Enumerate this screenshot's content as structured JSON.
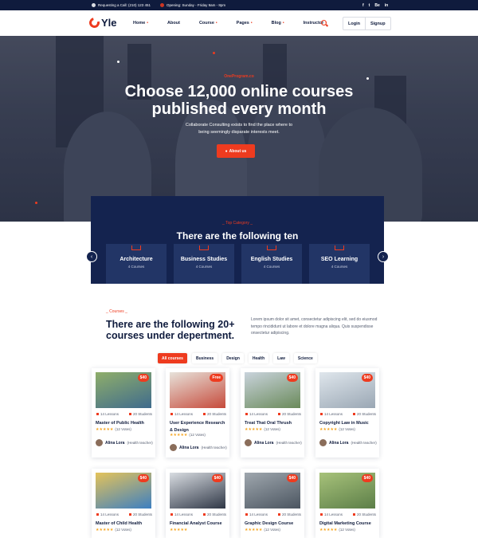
{
  "topbar": {
    "call": "Requesting a Call: (210) 123 451",
    "opening": "Opening: Sunday - Friday 9am - 8pm",
    "social": [
      "f",
      "t",
      "Be",
      "in"
    ]
  },
  "header": {
    "logo_text": "Yle",
    "nav": [
      "Home",
      "About",
      "Course",
      "Pages",
      "Blog",
      "Instructor"
    ],
    "login": "Login",
    "signup": "Signup"
  },
  "hero": {
    "subtitle": "OneProgram.co",
    "title_line1": "Choose 12,000 online courses",
    "title_line2": "published every month",
    "desc_line1": "Collaborate Consulting exists to find the place where to",
    "desc_line2": "being seemingly disparate interests meet.",
    "button": "About us"
  },
  "category": {
    "subtitle": "_ Top Category _",
    "title": "There are the following ten",
    "cards": [
      {
        "title": "Architecture",
        "count": "4 Courses"
      },
      {
        "title": "Business Studies",
        "count": "4 Courses"
      },
      {
        "title": "English Studies",
        "count": "4 Courses"
      },
      {
        "title": "SEO Learning",
        "count": "4 Courses"
      }
    ]
  },
  "courses": {
    "subtitle": "_ Courses _",
    "title": "There are the following 20+ courses under depertment.",
    "description": "Lorem ipsum dolor sit amet, consectetur adipiscing elit, sed do eiusmod tempo rincididunt ut labore et dolore magna aliqua. Quis suspendisse onsectetur adipiscing.",
    "tabs": [
      "All courses",
      "Business",
      "Design",
      "Health",
      "Law",
      "Science"
    ],
    "active_tab": "All courses",
    "cards": [
      {
        "price": "$40",
        "lessons": "14 Lessons",
        "students": "20 Students",
        "title": "Master of Public Health",
        "votes": "(12 Votes)",
        "author": "Alina Lora",
        "role": "(Health teacher)"
      },
      {
        "price": "Free",
        "lessons": "14 Lessons",
        "students": "20 Students",
        "title": "User Experience Research & Design",
        "votes": "(12 Votes)",
        "author": "Alina Lora",
        "role": "(Health teacher)"
      },
      {
        "price": "$40",
        "lessons": "14 Lessons",
        "students": "20 Students",
        "title": "Treat That Oral Thrush",
        "votes": "(12 Votes)",
        "author": "Alina Lora",
        "role": "(Health teacher)"
      },
      {
        "price": "$40",
        "lessons": "14 Lessons",
        "students": "20 Students",
        "title": "Copyright Law in Music",
        "votes": "(12 Votes)",
        "author": "Alina Lora",
        "role": "(Health teacher)"
      },
      {
        "price": "$40",
        "lessons": "14 Lessons",
        "students": "20 Students",
        "title": "Master of Child Health",
        "votes": "(12 Votes)"
      },
      {
        "price": "$40",
        "lessons": "14 Lessons",
        "students": "20 Students",
        "title": "Financial Analyst Course",
        "votes": ""
      },
      {
        "price": "$40",
        "lessons": "14 Lessons",
        "students": "20 Students",
        "title": "Graphic Design Course",
        "votes": "(12 Votes)"
      },
      {
        "price": "$40",
        "lessons": "14 Lessons",
        "students": "20 Students",
        "title": "Digital Marketing Course",
        "votes": "(12 Votes)"
      }
    ],
    "stars": "★★★★★"
  },
  "colors": {
    "accent": "#ee3b1f",
    "navy": "#0f1b3d",
    "panel": "#14234f"
  }
}
